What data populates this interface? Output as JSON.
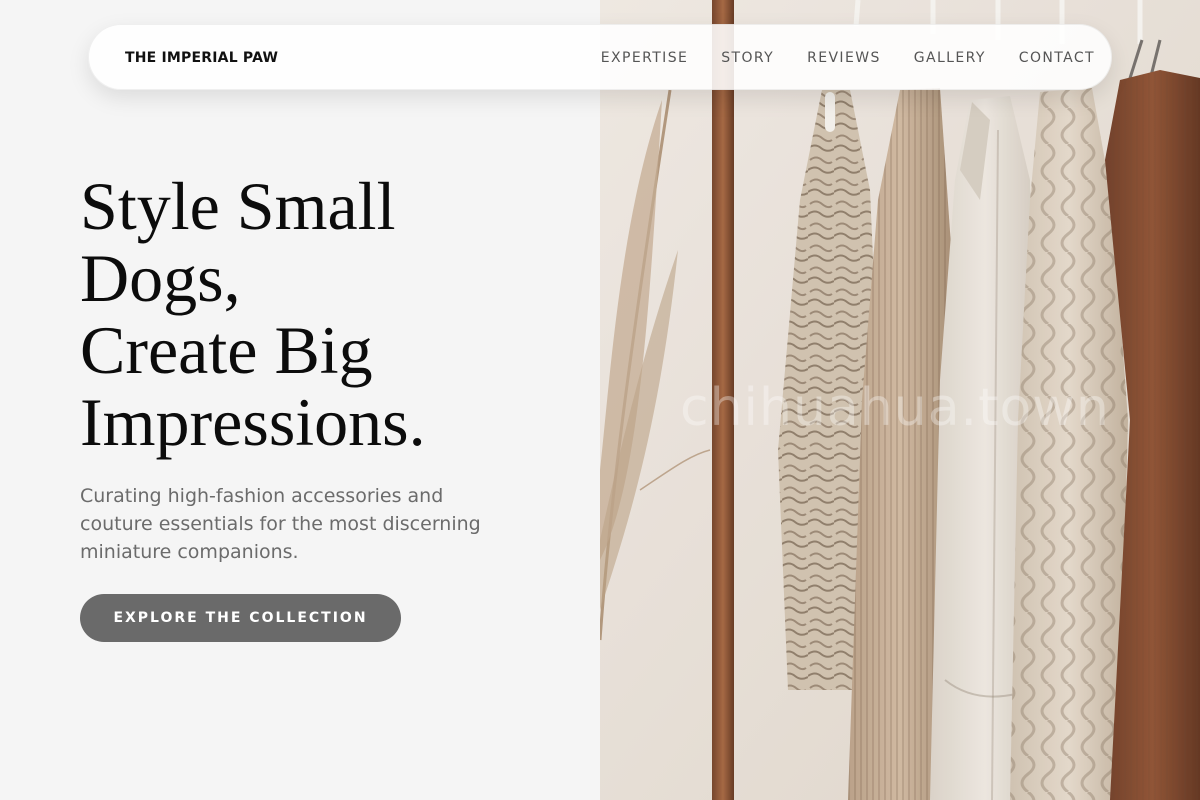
{
  "brand": {
    "name": "THE IMPERIAL PAW"
  },
  "nav": {
    "links": [
      "EXPERTISE",
      "STORY",
      "REVIEWS",
      "GALLERY",
      "CONTACT"
    ]
  },
  "hero": {
    "title_lines": [
      "Style Small",
      "Dogs,",
      "Create Big",
      "Impressions."
    ],
    "subtitle": "Curating high-fashion accessories and couture essentials for the most discerning miniature companions.",
    "cta_label": "EXPLORE THE COLLECTION"
  },
  "image": {
    "watermark": "chihuahua.town"
  },
  "colors": {
    "background": "#f5f5f5",
    "cta": "#6a6a6a",
    "text_muted": "#6b6b6b"
  }
}
